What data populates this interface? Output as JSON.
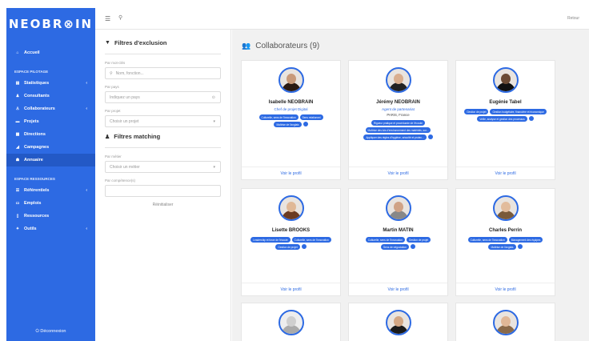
{
  "app": {
    "logo": "NEOBR⊗IN"
  },
  "sidebar": {
    "accueil": "Accueil",
    "section_pilotage": "ESPACE PILOTAGE",
    "pilotage_items": [
      {
        "label": "Statistiques",
        "icon": "chart-icon",
        "chevron": true
      },
      {
        "label": "Consultants",
        "icon": "users-icon",
        "chevron": false
      },
      {
        "label": "Collaborateurs",
        "icon": "user-icon",
        "chevron": true
      },
      {
        "label": "Projets",
        "icon": "folder-icon",
        "chevron": false
      },
      {
        "label": "Directions",
        "icon": "building-icon",
        "chevron": false
      },
      {
        "label": "Campagnes",
        "icon": "campaign-icon",
        "chevron": false
      },
      {
        "label": "Annuaire",
        "icon": "people-icon",
        "chevron": false
      }
    ],
    "section_ressources": "ESPACE RESSOURCES",
    "ressources_items": [
      {
        "label": "Référentiels",
        "icon": "list-icon",
        "chevron": true
      },
      {
        "label": "Emplois",
        "icon": "briefcase-icon",
        "chevron": false
      },
      {
        "label": "Ressources",
        "icon": "book-icon",
        "chevron": false
      },
      {
        "label": "Outils",
        "icon": "wrench-icon",
        "chevron": true
      }
    ],
    "logout": "⏻ Déconnexion"
  },
  "topbar": {
    "right": "Retour"
  },
  "filters": {
    "exclusion_title": "Filtres d'exclusion",
    "mot_cle_label": "Par mot-clés",
    "mot_cle_placeholder": "Nom, fonction...",
    "pays_label": "Par pays",
    "pays_placeholder": "Indiquez un pays",
    "projet_label": "Par projet",
    "projet_placeholder": "Choisir un projet",
    "matching_title": "Filtres matching",
    "metier_label": "Par métier",
    "metier_placeholder": "Choisir un métier",
    "competence_label": "Par compétence(s)",
    "reset": "Réinitialiser"
  },
  "main": {
    "title": "Collaborateurs (9)",
    "view_profile": "Voir le profil",
    "cards": [
      {
        "name": "Isabelle NEOBRAIN",
        "role": "Chef de projet Digital",
        "location": "",
        "tags": [
          "Culturelle, sens de l'innovation",
          "Sens relationnel",
          "Maîtrise de l'anglais"
        ],
        "more": true
      },
      {
        "name": "Jérémy NEOBRAIN",
        "role": "Agent de partenariat",
        "location": "PARIS, France",
        "tags": [
          "Rigueur pratique et procédurale de l'écoute",
          "Maîtrise des lois d'environnement des matériels, sur...",
          "Appliquer des règles d'hygiène, sécurité et protec..."
        ],
        "more": true
      },
      {
        "name": "Eugénie Tabel",
        "role": "",
        "location": "",
        "tags": [
          "Gestion de projet",
          "Gestion budgétaire, financière et économique",
          "Veille, analyse et gestion des processus"
        ],
        "more": true
      },
      {
        "name": "Lisette BROOKS",
        "role": "",
        "location": "",
        "tags": [
          "Leadership et force de l'écoute",
          "Culturelle, sens de l'innovation",
          "Gestion de projet"
        ],
        "more": true
      },
      {
        "name": "Martin MATIN",
        "role": "",
        "location": "",
        "tags": [
          "Culturelle, sens de l'innovation",
          "Gestion de projet",
          "Sens de négociation"
        ],
        "more": true
      },
      {
        "name": "Charles Perrin",
        "role": "",
        "location": "",
        "tags": [
          "Culturelle, sens de l'innovation",
          "Management des équipes",
          "Maîtrise de l'anglais"
        ],
        "more": true
      },
      {
        "name": "",
        "role": "",
        "location": "",
        "tags": [],
        "more": false
      },
      {
        "name": "",
        "role": "",
        "location": "",
        "tags": [],
        "more": false
      },
      {
        "name": "",
        "role": "",
        "location": "",
        "tags": [],
        "more": false
      }
    ]
  },
  "colors": {
    "accent": "#2d6ae3",
    "bg": "#f1f1f1"
  }
}
